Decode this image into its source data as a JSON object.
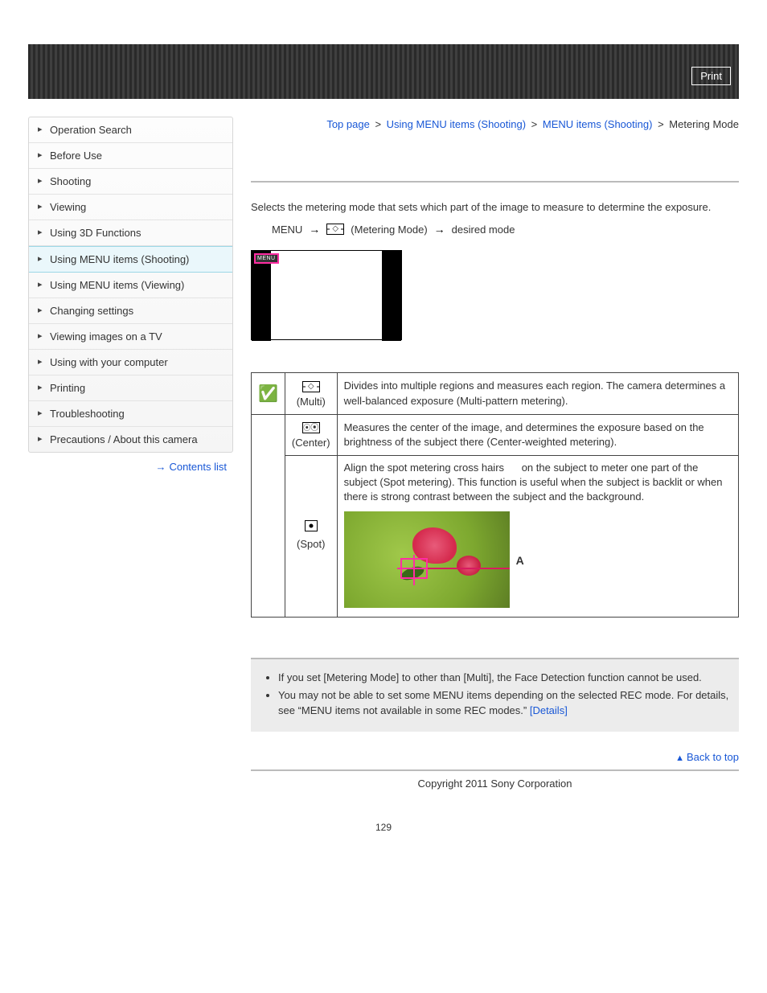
{
  "header": {
    "print_label": "Print"
  },
  "sidebar": {
    "items": [
      {
        "label": "Operation Search"
      },
      {
        "label": "Before Use"
      },
      {
        "label": "Shooting"
      },
      {
        "label": "Viewing"
      },
      {
        "label": "Using 3D Functions"
      },
      {
        "label": "Using MENU items (Shooting)"
      },
      {
        "label": "Using MENU items (Viewing)"
      },
      {
        "label": "Changing settings"
      },
      {
        "label": "Viewing images on a TV"
      },
      {
        "label": "Using with your computer"
      },
      {
        "label": "Printing"
      },
      {
        "label": "Troubleshooting"
      },
      {
        "label": "Precautions / About this camera"
      }
    ],
    "contents_link": "Contents list"
  },
  "breadcrumb": {
    "top": "Top page",
    "a": "Using MENU items (Shooting)",
    "b": "MENU items (Shooting)",
    "current": "Metering Mode"
  },
  "main": {
    "intro": "Selects the metering mode that sets which part of the image to measure to determine the exposure.",
    "menu_label": "MENU",
    "metering_label": "(Metering Mode)",
    "desired_label": "desired mode",
    "screenshot_menu_tag": "MENU",
    "table": {
      "multi_caption": "(Multi)",
      "multi_desc": "Divides into multiple regions and measures each region. The camera determines a well-balanced exposure (Multi-pattern metering).",
      "center_caption": "(Center)",
      "center_desc": "Measures the center of the image, and determines the exposure based on the brightness of the subject there (Center-weighted metering).",
      "spot_caption": "(Spot)",
      "spot_desc_part1": "Align the spot metering cross hairs",
      "spot_desc_part2": "on the subject to meter one part of the subject (Spot metering). This function is useful when the subject is backlit or when there is strong contrast between the subject and the background.",
      "label_A": "A"
    },
    "notes": {
      "n1": "If you set [Metering Mode] to other than [Multi], the Face Detection function cannot be used.",
      "n2a": "You may not be able to set some MENU items depending on the selected REC mode. For details, see “MENU items not available in some REC modes.” ",
      "n2_link": "[Details]"
    },
    "back_to_top": "Back to top"
  },
  "footer": {
    "copyright": "Copyright 2011 Sony Corporation",
    "page_number": "129"
  }
}
